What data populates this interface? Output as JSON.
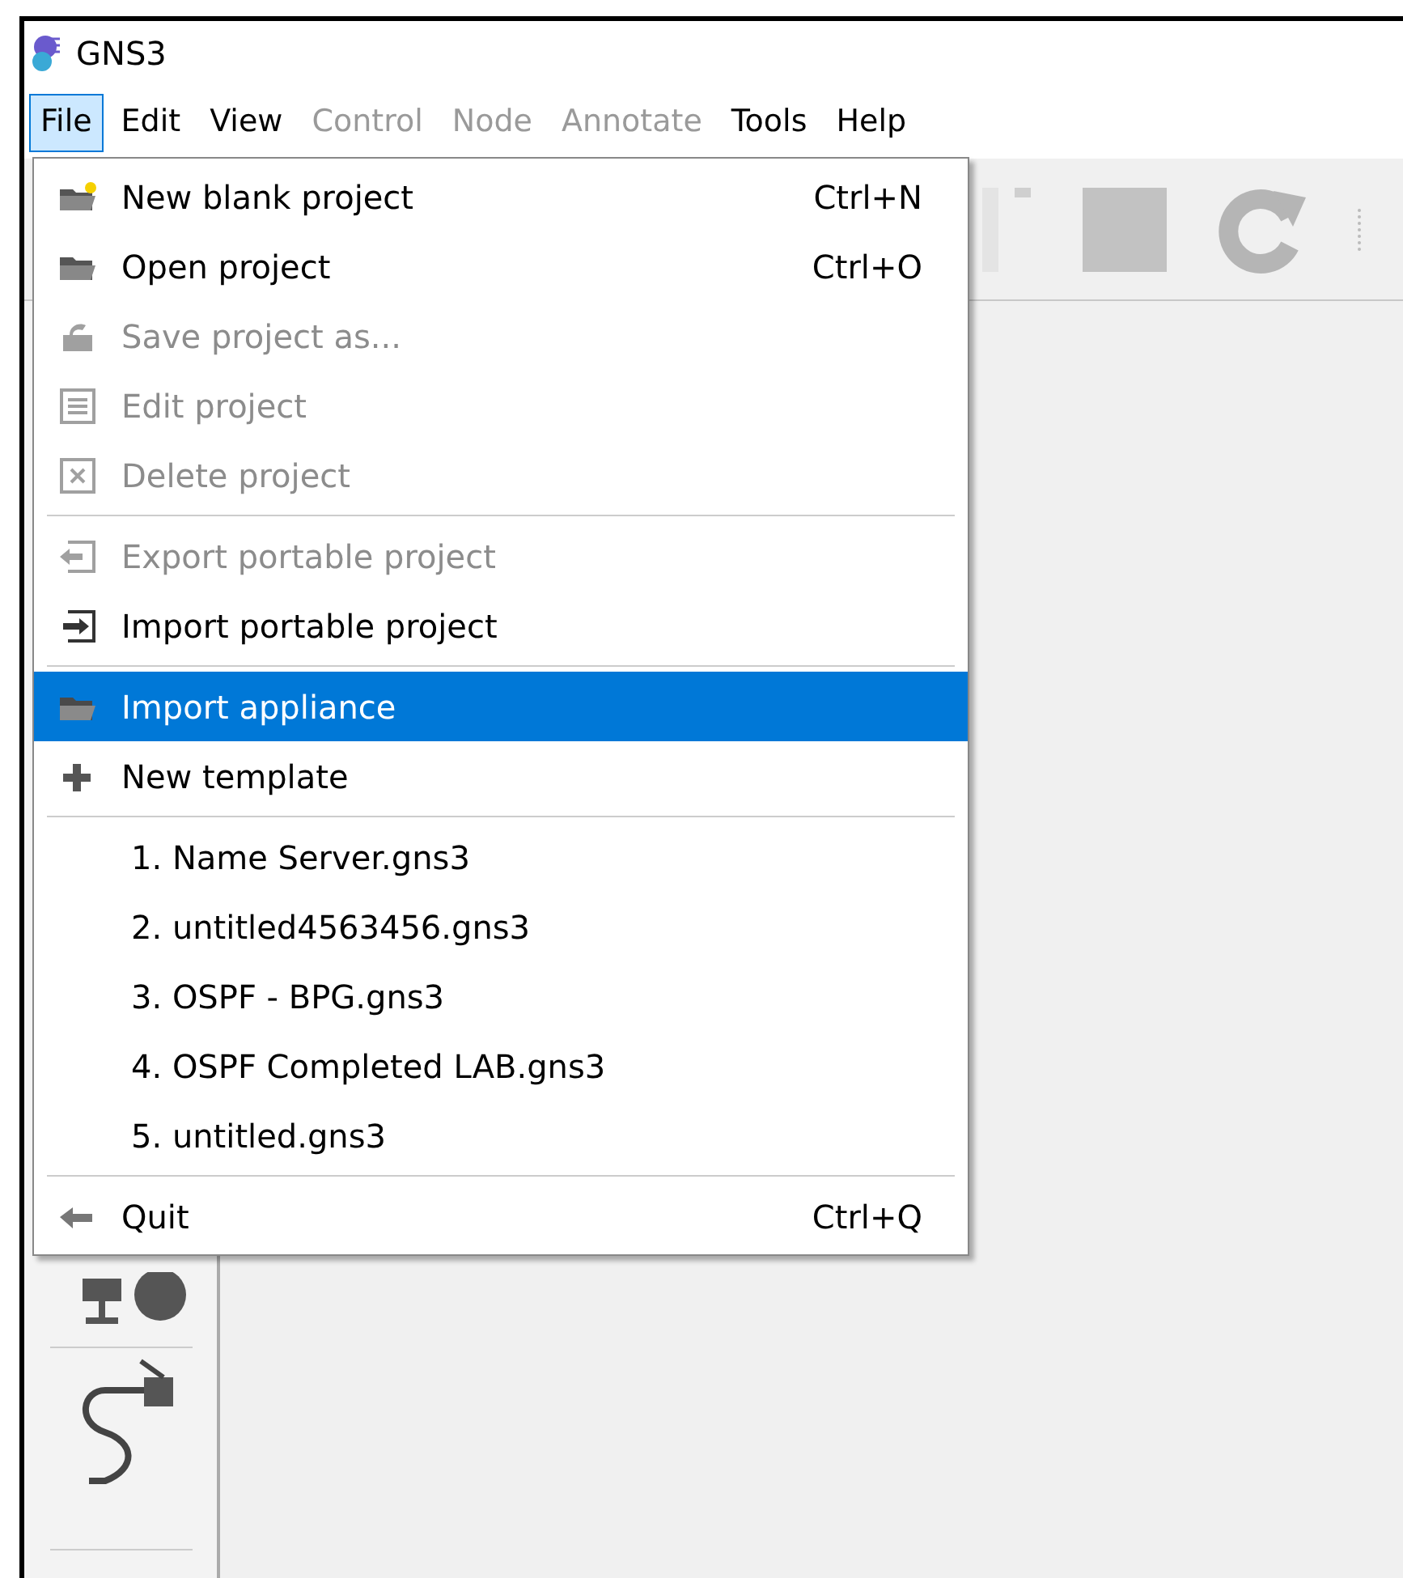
{
  "window": {
    "title": "GNS3"
  },
  "menu_bar": [
    {
      "label": "File",
      "selected": true,
      "disabled": false
    },
    {
      "label": "Edit",
      "selected": false,
      "disabled": false
    },
    {
      "label": "View",
      "selected": false,
      "disabled": false
    },
    {
      "label": "Control",
      "selected": false,
      "disabled": true
    },
    {
      "label": "Node",
      "selected": false,
      "disabled": true
    },
    {
      "label": "Annotate",
      "selected": false,
      "disabled": true
    },
    {
      "label": "Tools",
      "selected": false,
      "disabled": false
    },
    {
      "label": "Help",
      "selected": false,
      "disabled": false
    }
  ],
  "file_menu": {
    "sections": [
      {
        "items": [
          {
            "label": "New blank project",
            "shortcut": "Ctrl+N",
            "disabled": false,
            "selected": false
          },
          {
            "label": "Open project",
            "shortcut": "Ctrl+O",
            "disabled": false,
            "selected": false
          },
          {
            "label": "Save project as...",
            "disabled": true,
            "selected": false
          },
          {
            "label": "Edit project",
            "disabled": true,
            "selected": false
          },
          {
            "label": "Delete project",
            "disabled": true,
            "selected": false
          }
        ]
      },
      {
        "items": [
          {
            "label": "Export portable project",
            "disabled": true,
            "selected": false
          },
          {
            "label": "Import portable project",
            "disabled": false,
            "selected": false
          }
        ]
      },
      {
        "items": [
          {
            "label": "Import appliance",
            "disabled": false,
            "selected": true
          },
          {
            "label": "New template",
            "disabled": false,
            "selected": false
          }
        ]
      },
      {
        "items": [
          {
            "label": "1. Name Server.gns3",
            "disabled": false,
            "selected": false
          },
          {
            "label": "2. untitled4563456.gns3",
            "disabled": false,
            "selected": false
          },
          {
            "label": "3. OSPF - BPG.gns3",
            "disabled": false,
            "selected": false
          },
          {
            "label": "4. OSPF Completed LAB.gns3",
            "disabled": false,
            "selected": false
          },
          {
            "label": "5. untitled.gns3",
            "disabled": false,
            "selected": false
          }
        ]
      },
      {
        "items": [
          {
            "label": "Quit",
            "shortcut": "Ctrl+Q",
            "disabled": false,
            "selected": false
          }
        ]
      }
    ]
  }
}
